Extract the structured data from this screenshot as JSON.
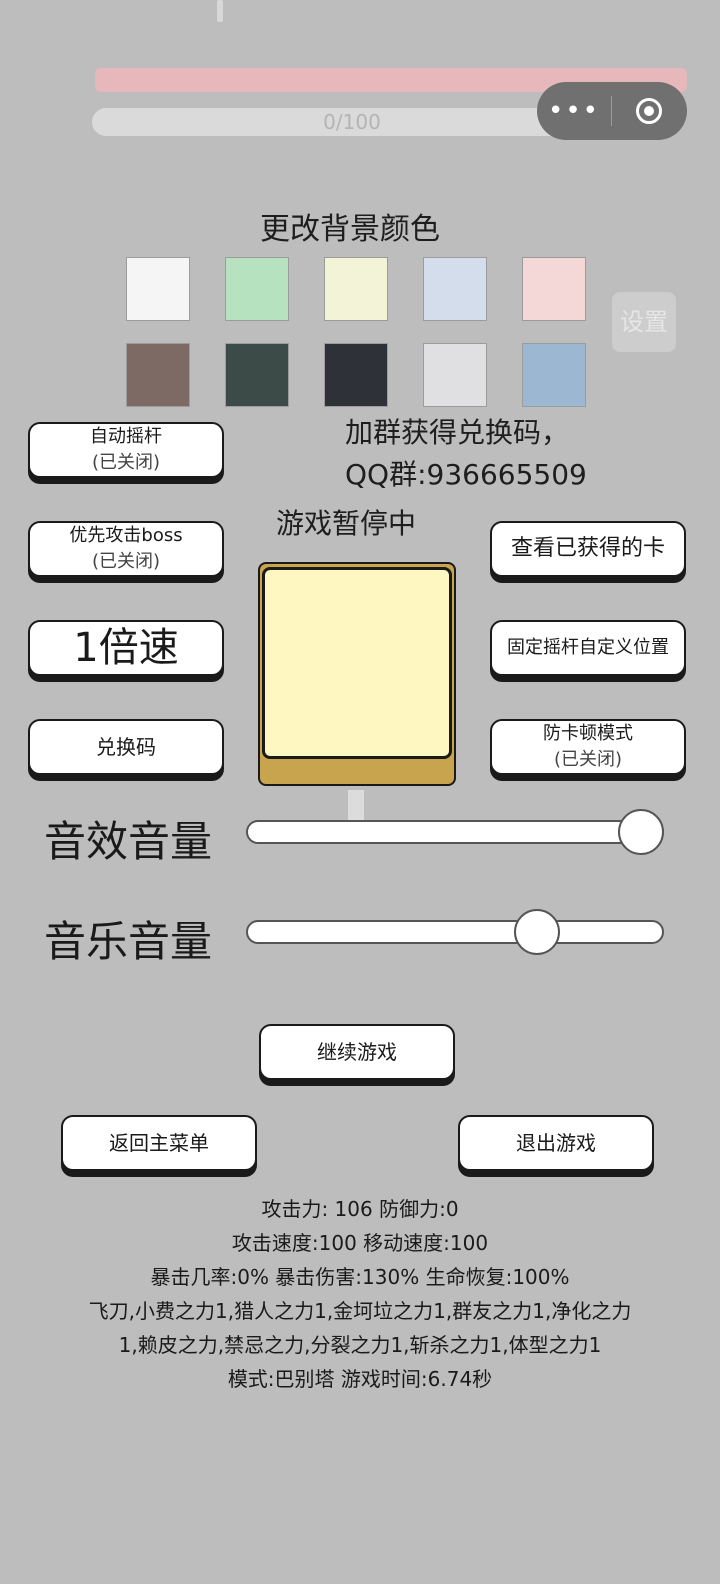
{
  "top": {
    "hp_label": "",
    "xp_label": "0/100",
    "capsule_more": "•••"
  },
  "background_panel": {
    "title": "更改背景颜色",
    "settings_label": "设置",
    "colors": [
      "#f5f5f5",
      "#b6e2c0",
      "#f3f3d8",
      "#d4ddec",
      "#f4d8d8",
      "#7d6a65",
      "#3c4a48",
      "#2f3138",
      "#e0e0e3",
      "#9bb7d2"
    ]
  },
  "buttons": {
    "auto_joystick": {
      "title": "自动摇杆",
      "state": "(已关闭)"
    },
    "prioritize_boss": {
      "title": "优先攻击boss",
      "state": "(已关闭)"
    },
    "speed": {
      "title": "1倍速"
    },
    "redeem_code": {
      "title": "兑换码"
    },
    "view_cards": {
      "title": "查看已获得的卡"
    },
    "fixed_joystick": {
      "title": "固定摇杆自定义位置"
    },
    "anti_lag": {
      "title": "防卡顿模式",
      "state": "(已关闭)"
    },
    "continue": {
      "title": "继续游戏"
    },
    "main_menu": {
      "title": "返回主菜单"
    },
    "exit": {
      "title": "退出游戏"
    }
  },
  "group_info": {
    "line1": "加群获得兑换码，",
    "line2": "QQ群:936665509"
  },
  "paused_label": "游戏暂停中",
  "volume": {
    "sfx_label": "音效音量",
    "sfx_level": 1.0,
    "music_label": "音乐音量",
    "music_level": 0.72
  },
  "stats": {
    "line1": "攻击力: 106 防御力:0",
    "line2": "攻击速度:100 移动速度:100",
    "line3": "暴击几率:0% 暴击伤害:130% 生命恢复:100%",
    "line4": "飞刀,小费之力1,猎人之力1,金坷垃之力1,群友之力1,净化之力",
    "line5": "1,赖皮之力,禁忌之力,分裂之力1,斩杀之力1,体型之力1",
    "line6": "模式:巴别塔 游戏时间:6.74秒"
  }
}
